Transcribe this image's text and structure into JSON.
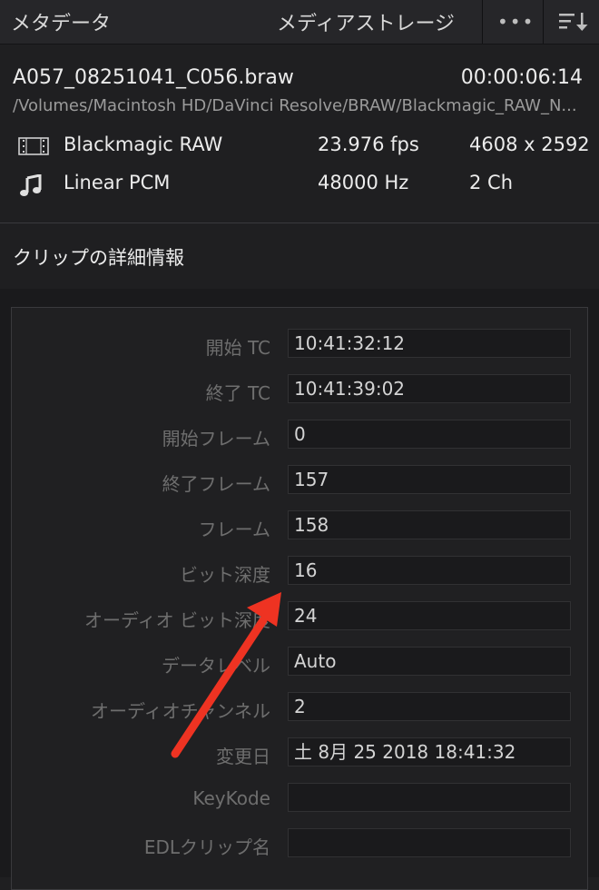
{
  "header": {
    "title": "メタデータ",
    "storage_label": "メディアストレージ",
    "more_icon": "more-icon",
    "sort_icon": "sort-icon"
  },
  "clip": {
    "filename": "A057_08251041_C056.braw",
    "duration": "00:00:06:14",
    "path": "/Volumes/Macintosh HD/DaVinci Resolve/BRAW/Blackmagic_RAW_N..."
  },
  "video": {
    "icon": "film-icon",
    "codec": "Blackmagic RAW",
    "fps": "23.976 fps",
    "resolution": "4608 x 2592"
  },
  "audio": {
    "icon": "music-note-icon",
    "codec": "Linear PCM",
    "rate": "48000 Hz",
    "channels": "2 Ch"
  },
  "details": {
    "section_title": "クリップの詳細情報",
    "fields": [
      {
        "label": "開始 TC",
        "value": "10:41:32:12"
      },
      {
        "label": "終了 TC",
        "value": "10:41:39:02"
      },
      {
        "label": "開始フレーム",
        "value": "0"
      },
      {
        "label": "終了フレーム",
        "value": "157"
      },
      {
        "label": "フレーム",
        "value": "158"
      },
      {
        "label": "ビット深度",
        "value": "16"
      },
      {
        "label": "オーディオ ビット深度",
        "value": "24"
      },
      {
        "label": "データレベル",
        "value": "Auto"
      },
      {
        "label": "オーディオチャンネル",
        "value": "2"
      },
      {
        "label": "変更日",
        "value": "土 8月 25 2018 18:41:32"
      },
      {
        "label": "KeyKode",
        "value": ""
      },
      {
        "label": "EDLクリップ名",
        "value": ""
      }
    ]
  },
  "colors": {
    "annotation_arrow": "#ee3322"
  }
}
